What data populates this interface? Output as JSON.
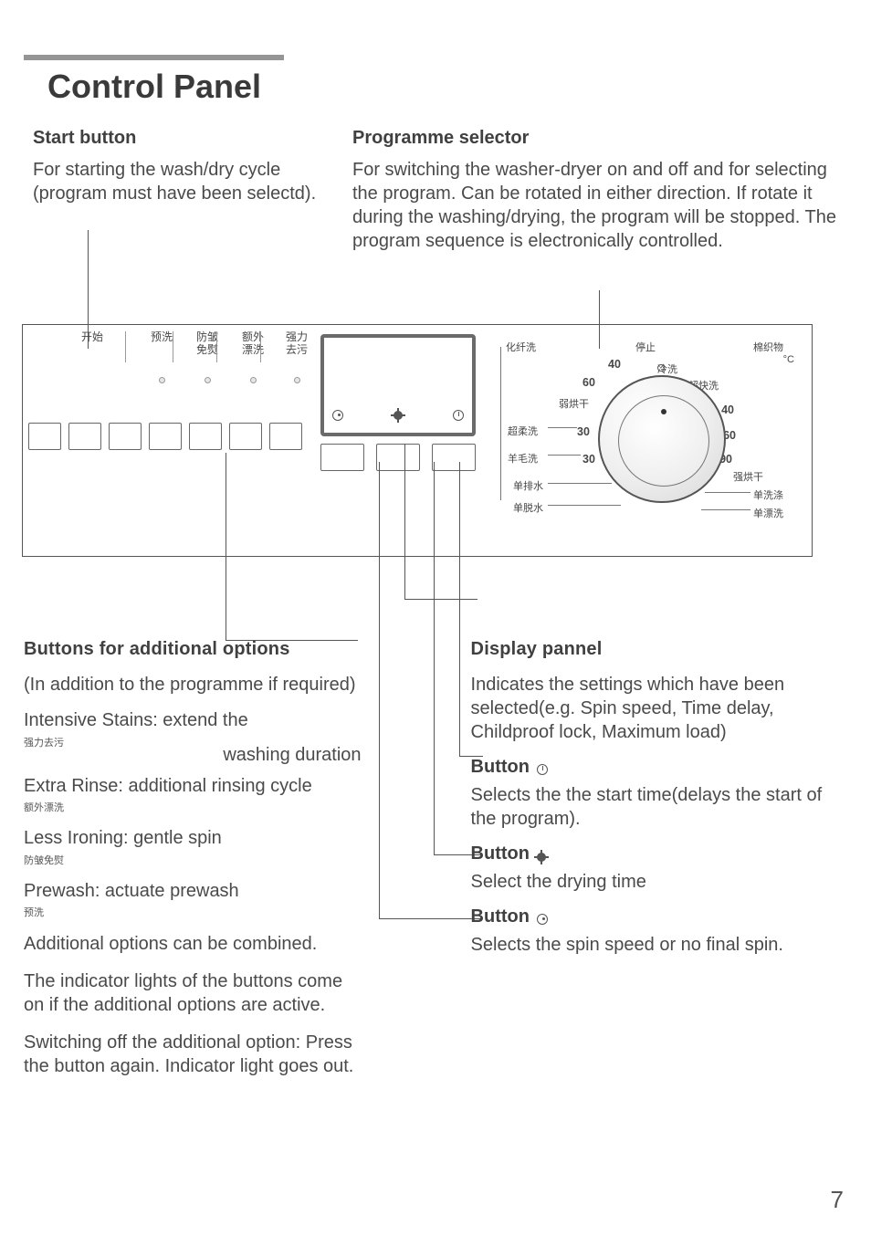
{
  "page_number": "7",
  "title": "Control Panel",
  "start": {
    "heading": "Start   button",
    "text": "For starting the wash/dry cycle (program must have been selectd)."
  },
  "selector": {
    "heading": "Programme selector",
    "text": "For switching the washer-dryer on and off and for selecting the program. Can be rotated in either direction. If rotate it during the washing/drying, the program will be stopped. The program sequence is electronically controlled."
  },
  "panel": {
    "button_labels": [
      {
        "l1": "开始",
        "l2": ""
      },
      {
        "l1": "预洗",
        "l2": ""
      },
      {
        "l1": "防皱",
        "l2": "免熨"
      },
      {
        "l1": "额外",
        "l2": "漂洗"
      },
      {
        "l1": "强力",
        "l2": "去污"
      }
    ],
    "dial": {
      "top_left": "化纤洗",
      "top_center": "停止",
      "top_right": "棉织物",
      "unit": "°C",
      "l1_left": "弱烘干",
      "l2_left": "超柔洗",
      "l3_left": "羊毛洗",
      "l4_left": "单排水",
      "l5_left": "单脱水",
      "r1": "冷洗",
      "r2": "超快洗",
      "r3": "40",
      "r4": "60",
      "r5": "90",
      "r6": "强烘干",
      "r7": "单洗涤",
      "r8": "单漂洗",
      "l40": "40",
      "l60": "60",
      "l30a": "30",
      "l30b": "30"
    }
  },
  "options": {
    "heading": "Buttons for additional options",
    "intro": "(In addition to the programme if required)",
    "o1": "Intensive Stains: extend the",
    "o1b": "washing duration",
    "o1_sub": "强力去污",
    "o2": "Extra Rinse: additional rinsing cycle",
    "o2_sub": "额外漂洗",
    "o3": "Less Ironing: gentle spin",
    "o3_sub": "防皱免熨",
    "o4": "Prewash: actuate prewash",
    "o4_sub": "预洗",
    "combine": "Additional options can be combined.",
    "active": "The indicator lights of the buttons come on if the additional options are active.",
    "off": "Switching off the additional option: Press the button again. Indicator light goes out."
  },
  "right": {
    "display_h": "Display pannel",
    "display_t": "Indicates the settings which have been selected(e.g. Spin speed, Time delay, Childproof lock, Maximum load)",
    "b_clock_h": "Button",
    "b_clock_t": "Selects the the start time(delays the start of the program).",
    "b_sun_h": "Button",
    "b_sun_t": "Select the drying time",
    "b_spin_h": "Button",
    "b_spin_t": "Selects the spin speed or no final spin."
  }
}
